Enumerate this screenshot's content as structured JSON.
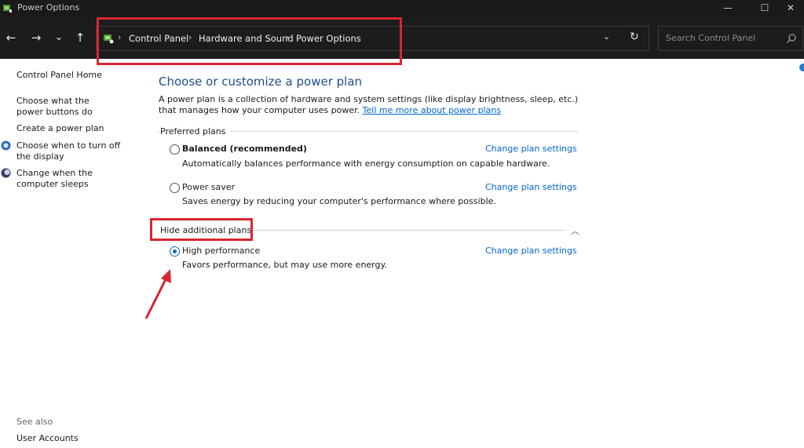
{
  "window": {
    "title": "Power Options",
    "minimize_glyph": "—",
    "maximize_glyph": "☐",
    "close_glyph": "✕"
  },
  "toolbar": {
    "back_glyph": "←",
    "forward_glyph": "→",
    "recent_glyph": "⌄",
    "up_glyph": "↑"
  },
  "address": {
    "crumbs": [
      "Control Panel",
      "Hardware and Sound",
      "Power Options"
    ],
    "separator": "›",
    "dropdown_glyph": "⌄",
    "refresh_glyph": "↻"
  },
  "search": {
    "placeholder": "Search Control Panel"
  },
  "sidebar": {
    "home": "Control Panel Home",
    "links": [
      "Choose what the power buttons do",
      "Create a power plan",
      "Choose when to turn off the display",
      "Change when the computer sleeps"
    ],
    "see_also_label": "See also",
    "see_also_links": [
      "User Accounts"
    ]
  },
  "main": {
    "heading": "Choose or customize a power plan",
    "intro_text": "A power plan is a collection of hardware and system settings (like display brightness, sleep, etc.) that manages how your computer uses power.",
    "intro_link": "Tell me more about power plans",
    "preferred_label": "Preferred plans",
    "plans": [
      {
        "name": "Balanced (recommended)",
        "description": "Automatically balances performance with energy consumption on capable hardware.",
        "link": "Change plan settings",
        "selected": false
      },
      {
        "name": "Power saver",
        "description": "Saves energy by reducing your computer's performance where possible.",
        "link": "Change plan settings",
        "selected": false
      }
    ],
    "additional_label": "Hide additional plans",
    "collapse_glyph": "︿",
    "additional_plans": [
      {
        "name": "High performance",
        "description": "Favors performance, but may use more energy.",
        "link": "Change plan settings",
        "selected": true
      }
    ]
  },
  "colors": {
    "annotation_red": "#d7262f",
    "link_blue": "#0066cc",
    "heading_blue": "#1e4e8a",
    "titlebar_dark": "#1a1a1a"
  }
}
